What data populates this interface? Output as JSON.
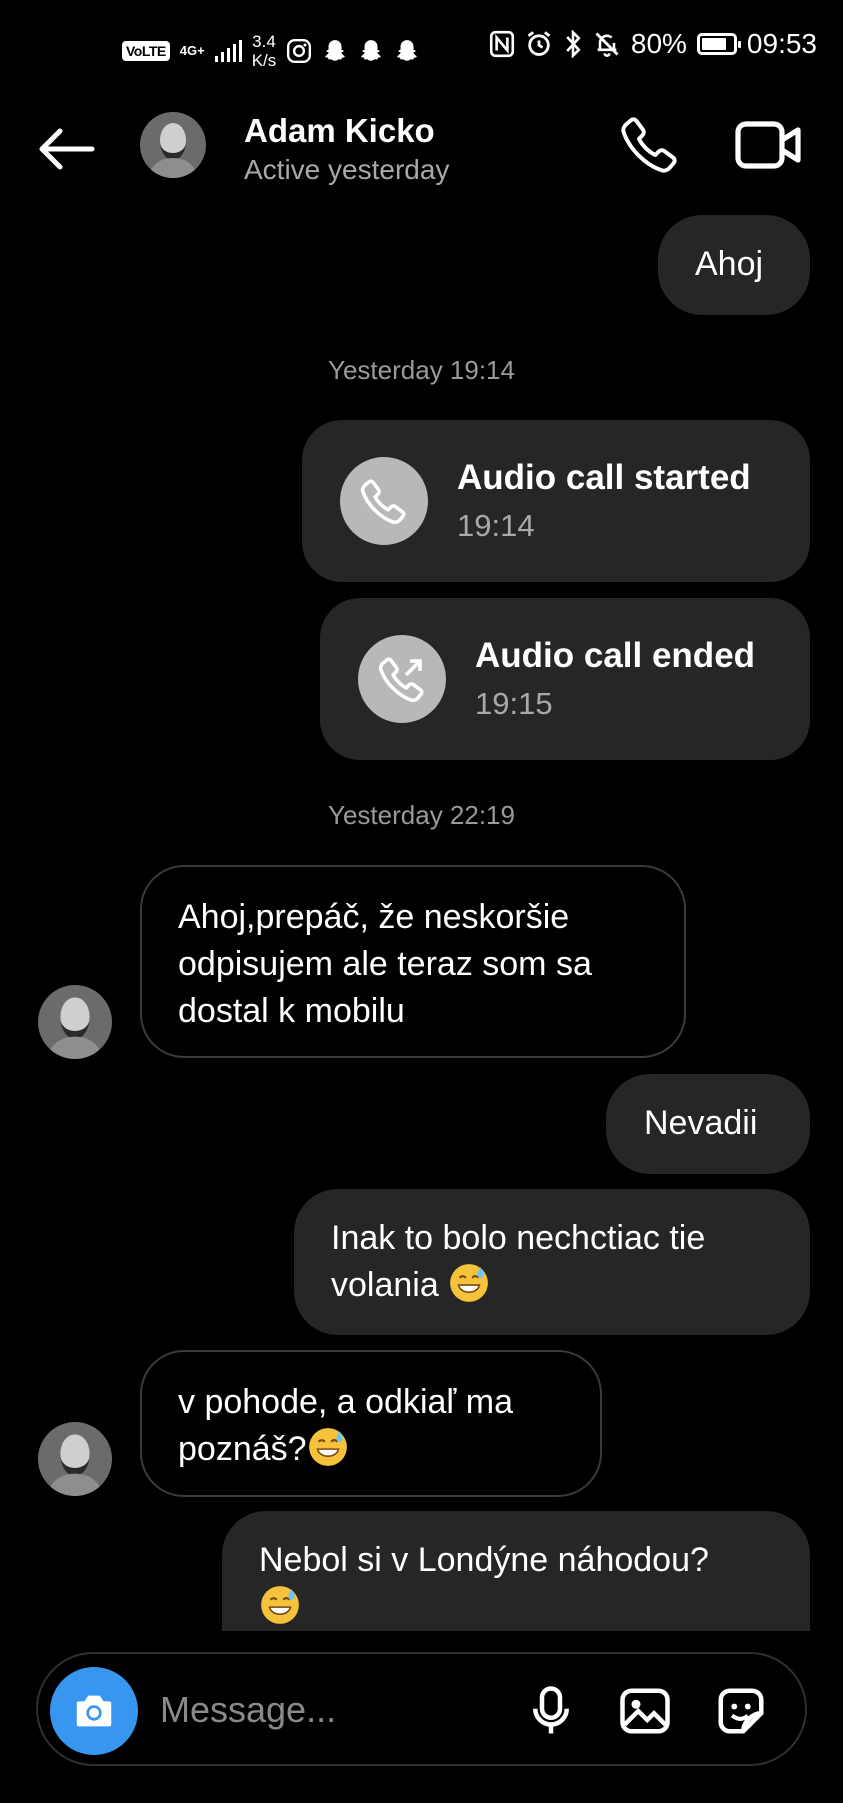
{
  "status_bar": {
    "volte": "VoLTE",
    "network": "4G+",
    "speed_value": "3.4",
    "speed_unit": "K/s",
    "battery": "80%",
    "battery_level": 0.8,
    "time": "09:53",
    "left_icons": [
      "instagram-icon",
      "snapchat-icon",
      "snapchat-icon",
      "snapchat-icon"
    ],
    "right_icons": [
      "nfc-icon",
      "alarm-icon",
      "bluetooth-icon",
      "mute-icon"
    ]
  },
  "header": {
    "name": "Adam Kicko",
    "status": "Active yesterday"
  },
  "messages": {
    "m1": "Ahoj",
    "ts1": "Yesterday 19:14",
    "call_started": {
      "title": "Audio call started",
      "time": "19:14"
    },
    "call_ended": {
      "title": "Audio call ended",
      "time": "19:15"
    },
    "ts2": "Yesterday 22:19",
    "m2": {
      "l1": "Ahoj,prepáč, že neskoršie",
      "l2": "odpisujem ale teraz som sa",
      "l3": "dostal k mobilu"
    },
    "m3": "Nevadii",
    "m4": {
      "l1": "Inak to bolo nechctiac tie",
      "l2": "volania"
    },
    "m5": {
      "l1": "v pohode, a odkiaľ ma",
      "l2": "poznáš?"
    },
    "m6": {
      "l1": "Nebol si v Londýne náhodou?"
    }
  },
  "composer": {
    "placeholder": "Message..."
  },
  "colors": {
    "background": "#000000",
    "bubble_out": "#262626",
    "bubble_in_border": "#3a3a3a",
    "accent": "#3797f0",
    "call_icon_bg": "#b8b8b8"
  }
}
